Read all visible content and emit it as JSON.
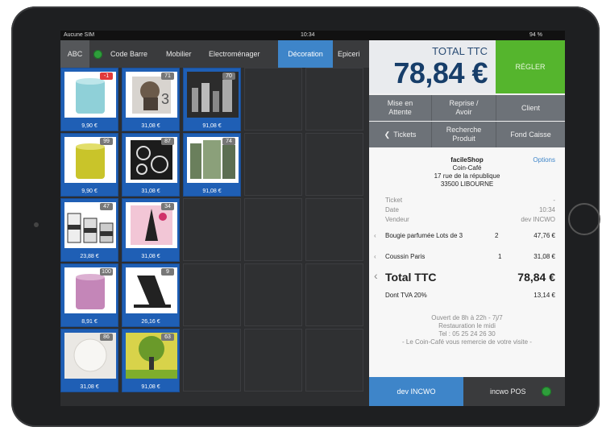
{
  "statusbar": {
    "carrier": "Aucune SIM",
    "time": "10:34",
    "battery": "94 %"
  },
  "tabs": [
    {
      "label": "ABC"
    },
    {
      "label": "Code Barre"
    },
    {
      "label": "Mobilier"
    },
    {
      "label": "Electroménager"
    },
    {
      "label": "Décoration"
    },
    {
      "label": "Epiceri"
    }
  ],
  "products": [
    {
      "price": "9,90 €",
      "badge": "-1",
      "icon": "candle-teal-image"
    },
    {
      "price": "31,08 €",
      "badge": "71",
      "icon": "pug-cushion-image"
    },
    {
      "price": "91,08 €",
      "badge": "70",
      "icon": "new-york-canvas-image"
    },
    {
      "price": "9,90 €",
      "badge": "99",
      "icon": "candle-yellow-image"
    },
    {
      "price": "31,08 €",
      "badge": "87",
      "icon": "swirl-cushion-image"
    },
    {
      "price": "91,08 €",
      "badge": "74",
      "icon": "city-canvas-image"
    },
    {
      "price": "23,88 €",
      "badge": "47",
      "icon": "candle-set-image"
    },
    {
      "price": "31,08 €",
      "badge": "34",
      "icon": "paris-cushion-image"
    },
    {
      "price": "8,91 €",
      "badge": "100",
      "icon": "candle-purple-image"
    },
    {
      "price": "26,16 €",
      "badge": "9",
      "icon": "magazine-rack-image"
    },
    {
      "price": "31,08 €",
      "badge": "86",
      "icon": "white-fur-cushion-image"
    },
    {
      "price": "91,08 €",
      "badge": "63",
      "icon": "tree-canvas-image"
    }
  ],
  "total": {
    "label": "TOTAL TTC",
    "amount": "78,84 €",
    "pay_label": "RÉGLER"
  },
  "actions_row1": {
    "hold": "Mise en Attente",
    "refund": "Reprise / Avoir",
    "client": "Client"
  },
  "actions_row2": {
    "tickets": "Tickets",
    "search": "Recherche Produit",
    "cash": "Fond Caisse"
  },
  "receipt": {
    "shop_name": "facileShop",
    "options_label": "Options",
    "shop_sub": "Coin-Café",
    "address1": "17 rue de la république",
    "address2": "33500 LIBOURNE",
    "ticket_label": "Ticket",
    "ticket_value": "-",
    "date_label": "Date",
    "date_value": "10:34",
    "seller_label": "Vendeur",
    "seller_value": "dev INCWO",
    "lines": [
      {
        "name": "Bougie parfumée Lots de 3",
        "qty": "2",
        "amount": "47,76 €"
      },
      {
        "name": "Coussin Paris",
        "qty": "1",
        "amount": "31,08 €"
      }
    ],
    "total_label": "Total TTC",
    "total_value": "78,84 €",
    "tva_label": "Dont TVA 20%",
    "tva_value": "13,14 €",
    "footer1": "Ouvert de 8h à 22h - 7j/7",
    "footer2": "Restauration le midi",
    "footer3": "Tel : 05 25 24 26 30",
    "footer4": "- Le Coin-Café vous remercie de votre visite -"
  },
  "footer": {
    "user": "dev INCWO",
    "pos": "incwo POS"
  },
  "colors": {
    "accent": "#3e85c9",
    "pay": "#55b52d",
    "tile": "#1f5fb5",
    "total_text": "#173e6a"
  }
}
